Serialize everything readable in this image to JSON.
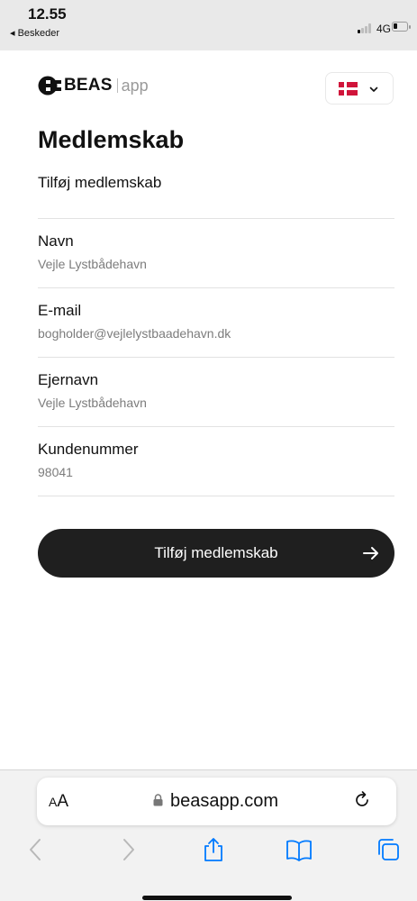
{
  "status_bar": {
    "time": "12.55",
    "back_label": "◂ Beskeder",
    "network": "4G"
  },
  "brand": {
    "name": "BEAS",
    "suffix": "app"
  },
  "language": {
    "flag": "denmark-flag-icon"
  },
  "page": {
    "title": "Medlemskab",
    "subtitle": "Tilføj medlemskab"
  },
  "fields": [
    {
      "label": "Navn",
      "value": "Vejle Lystbådehavn"
    },
    {
      "label": "E-mail",
      "value": "bogholder@vejlelystbaadehavn.dk"
    },
    {
      "label": "Ejernavn",
      "value": "Vejle Lystbådehavn"
    },
    {
      "label": "Kundenummer",
      "value": "98041"
    }
  ],
  "cta": {
    "label": "Tilføj medlemskab"
  },
  "browser": {
    "text_size_label_small": "A",
    "text_size_label_large": "A",
    "url": "beasapp.com"
  },
  "colors": {
    "button_bg": "#1f1f1f",
    "flag_red": "#d0143a",
    "browser_blue": "#007aff"
  }
}
